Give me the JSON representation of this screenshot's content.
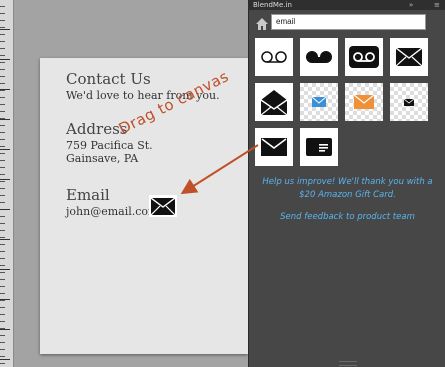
{
  "panel": {
    "title": "BlendMe.in",
    "search_value": "email",
    "home_icon": "home-icon",
    "results": [
      {
        "icon": "voicemail-outline-icon"
      },
      {
        "icon": "voicemail-filled-icon"
      },
      {
        "icon": "voicemail-boxed-icon"
      },
      {
        "icon": "envelope-filled-icon"
      },
      {
        "icon": "envelope-open-icon"
      },
      {
        "icon": "envelope-blue-icon",
        "color": "#3a8fd6"
      },
      {
        "icon": "envelope-orange-icon",
        "color": "#f0913a"
      },
      {
        "icon": "envelope-small-icon"
      },
      {
        "icon": "envelope-outline-icon"
      },
      {
        "icon": "card-icon"
      }
    ],
    "promo_line1": "Help us improve! We'll thank you with a",
    "promo_line2": "$20 Amazon Gift Card.",
    "feedback_link": "Send feedback to product team"
  },
  "artboard": {
    "contact_heading": "Contact Us",
    "contact_sub": "We'd love to hear from you.",
    "address_heading": "Address",
    "address_line1": "759 Pacifica St.",
    "address_line2": "Gainsave, PA",
    "email_heading": "Email",
    "email_value": "john@email.com"
  },
  "annotation": {
    "text": "Drag to canvas",
    "color": "#c0502a"
  }
}
